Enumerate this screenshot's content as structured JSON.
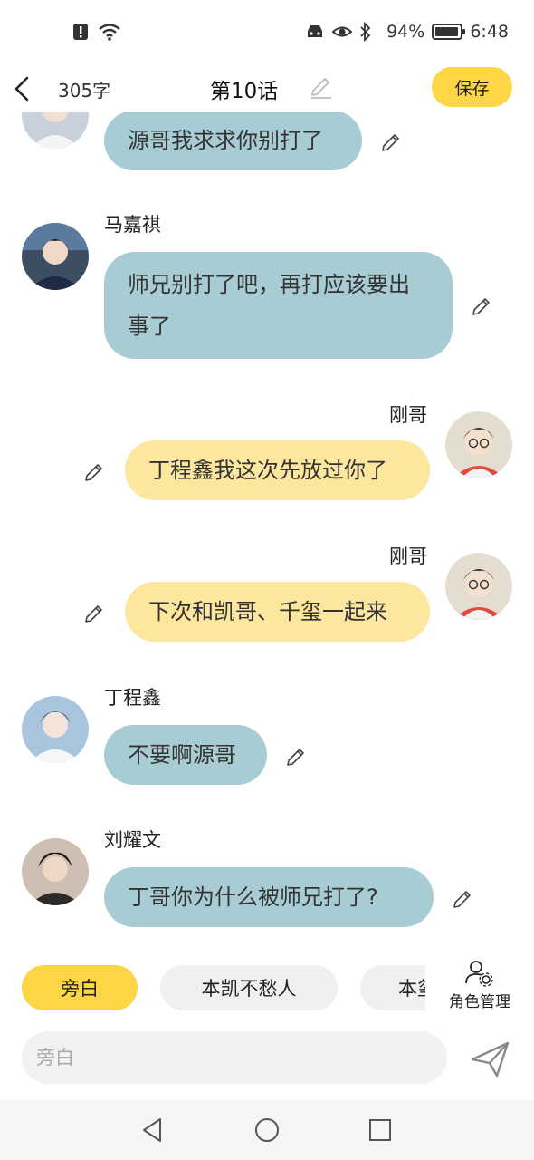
{
  "status_bar": {
    "battery_text": "94%",
    "battery_level": 0.94,
    "time": "6:48",
    "icons": [
      "alert-icon",
      "wifi-icon",
      "car-icon",
      "eye-icon",
      "bluetooth-icon",
      "battery-icon"
    ]
  },
  "header": {
    "word_count": "305字",
    "title": "第10话",
    "save_label": "保存"
  },
  "messages": [
    {
      "side": "left",
      "name": "",
      "text": "源哥我求求你别打了",
      "color": "#a8ccd3"
    },
    {
      "side": "left",
      "name": "马嘉祺",
      "text": "师兄别打了吧，再打应该要出事了",
      "color": "#a8ccd3"
    },
    {
      "side": "right",
      "name": "刚哥",
      "text": "丁程鑫我这次先放过你了",
      "color": "#fde69d"
    },
    {
      "side": "right",
      "name": "刚哥",
      "text": "下次和凯哥、千玺一起来",
      "color": "#fde69d"
    },
    {
      "side": "left",
      "name": "丁程鑫",
      "text": "不要啊源哥",
      "color": "#a8ccd3"
    },
    {
      "side": "left",
      "name": "刘耀文",
      "text": "丁哥你为什么被师兄打了?",
      "color": "#a8ccd3"
    }
  ],
  "roles": {
    "chips": [
      "旁白",
      "本凯不愁人",
      "本玺"
    ],
    "selected": "旁白",
    "manage_label": "角色管理"
  },
  "composer": {
    "placeholder": "旁白"
  },
  "colors": {
    "accent": "#fdd646",
    "bubble_left": "#a8ccd3",
    "bubble_right": "#fde69d"
  }
}
